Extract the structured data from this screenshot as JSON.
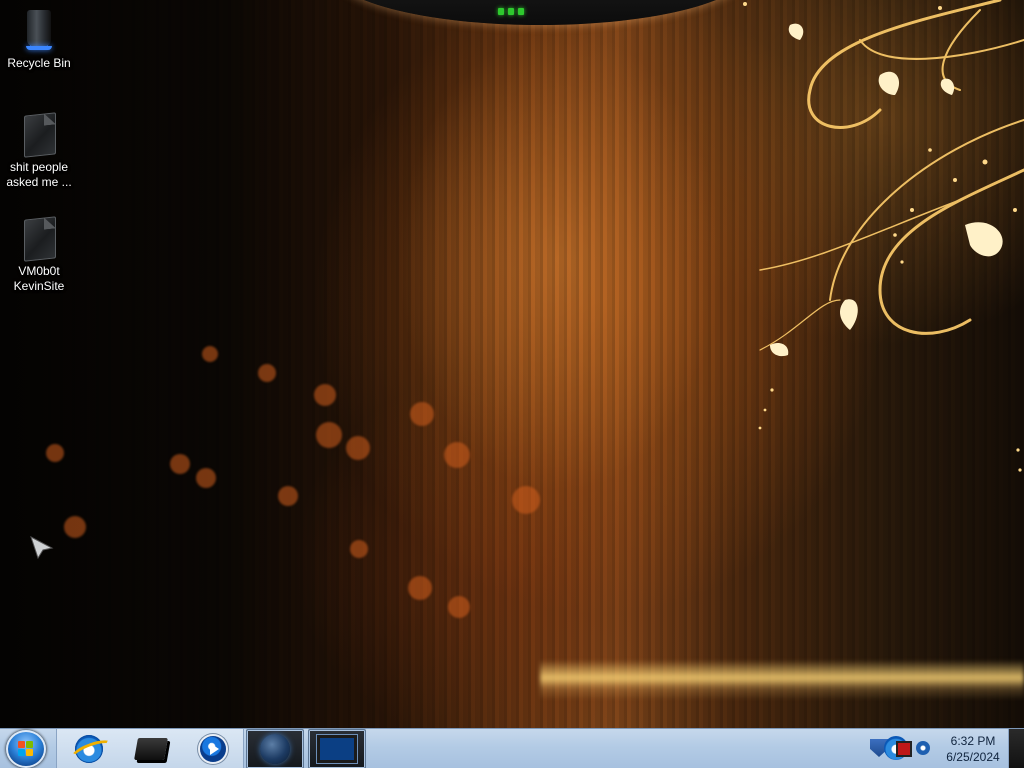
{
  "desktop": {
    "icons": [
      {
        "label": "Recycle Bin",
        "icon": "recycle-bin-icon"
      },
      {
        "label": "shit people asked me ...",
        "icon": "folder-icon"
      },
      {
        "label": "VM0b0t KevinSite",
        "icon": "folder-icon"
      }
    ]
  },
  "taskbar": {
    "start_button": {
      "icon": "windows-logo-icon"
    },
    "pinned": [
      {
        "name": "Internet Explorer",
        "icon": "internet-explorer-icon"
      },
      {
        "name": "Box",
        "icon": "box-app-icon"
      },
      {
        "name": "Windows Media Player",
        "icon": "media-player-icon"
      }
    ],
    "running": [
      {
        "icon": "globe-app-icon",
        "active": true
      },
      {
        "icon": "virtual-machine-icon",
        "active": true
      }
    ],
    "tray": {
      "icons": [
        "shield-icon",
        "internet-explorer-tray-icon",
        "flag-icon",
        "network-icon"
      ]
    },
    "clock": {
      "time": "6:32 PM",
      "date": "6/25/2024"
    }
  },
  "colors": {
    "taskbar": "#b3cbe5",
    "wallpaper_accent": "#d98a2c"
  }
}
